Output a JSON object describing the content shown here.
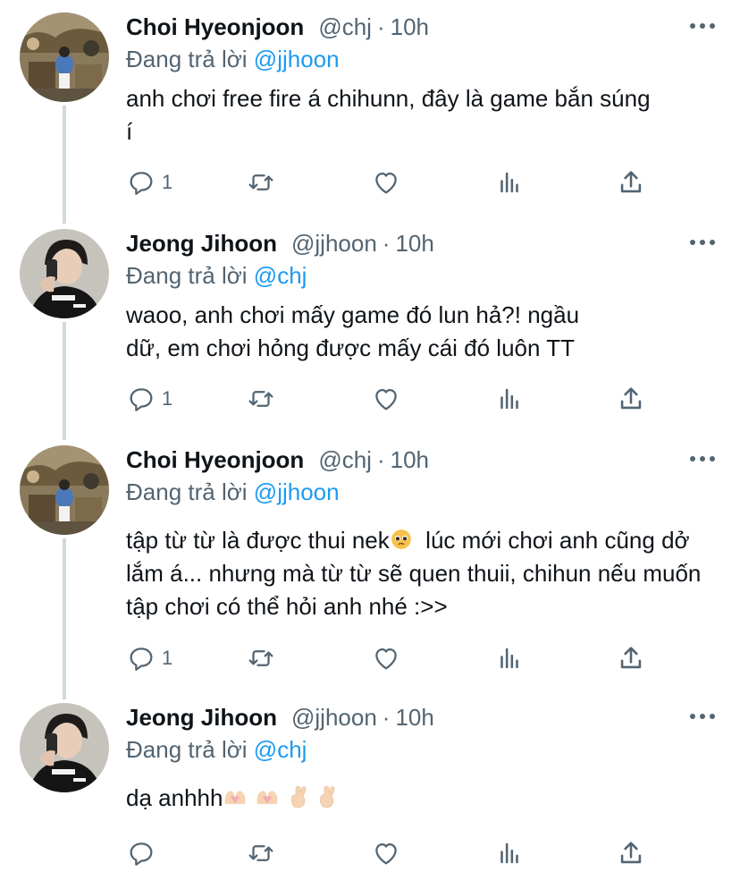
{
  "tweets": [
    {
      "name": "Choi Hyeonjoon",
      "handle": "@chj",
      "dot": "·",
      "time": "10h",
      "reply_prefix": "Đang trả lời",
      "reply_mention": "@jjhoon",
      "text": "anh chơi free fire á chihunn, đây là game bắn súng í",
      "reply_count": "1"
    },
    {
      "name": "Jeong Jihoon",
      "handle": "@jjhoon",
      "dot": "·",
      "time": "10h",
      "reply_prefix": "Đang trả lời",
      "reply_mention": "@chj",
      "text": "waoo, anh chơi mấy game đó lun hả?! ngầu dữ, em chơi hỏng được mấy cái đó luôn TT",
      "reply_count": "1"
    },
    {
      "name": "Choi Hyeonjoon",
      "handle": "@chj",
      "dot": "·",
      "time": "10h",
      "reply_prefix": "Đang trả lời",
      "reply_mention": "@jjhoon",
      "text_a": "tập từ từ là được thui nek",
      "text_b": "  lúc mới chơi anh cũng dở lắm á... nhưng mà từ từ sẽ quen thuii, chihun nếu muốn tập chơi có thể hỏi anh nhé :>>",
      "reply_count": "1"
    },
    {
      "name": "Jeong Jihoon",
      "handle": "@jjhoon",
      "dot": "·",
      "time": "10h",
      "reply_prefix": "Đang trả lời",
      "reply_mention": "@chj",
      "text": "dạ anhhh",
      "reply_count": ""
    }
  ],
  "icons": {
    "reply": "speech-bubble-icon",
    "retweet": "retweet-icon",
    "like": "heart-icon",
    "views": "bar-chart-icon",
    "share": "share-upload-icon",
    "more": "more-dots-icon"
  },
  "colors": {
    "accent": "#1d9bf0",
    "muted": "#536471",
    "thread_line": "#cfd9de"
  }
}
